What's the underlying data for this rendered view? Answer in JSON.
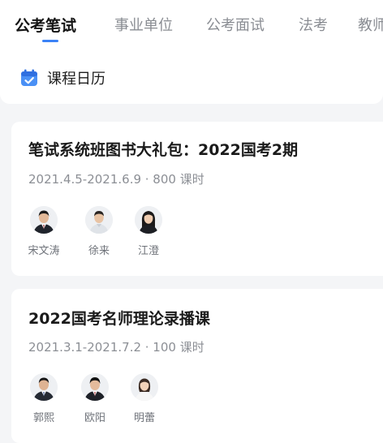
{
  "tabs": [
    {
      "label": "公考笔试",
      "active": true
    },
    {
      "label": "事业单位",
      "active": false
    },
    {
      "label": "公考面试",
      "active": false
    },
    {
      "label": "法考",
      "active": false
    },
    {
      "label": "教师",
      "active": false
    }
  ],
  "calendar": {
    "label": "课程日历",
    "icon": "calendar-check-icon"
  },
  "courses": [
    {
      "title": "笔试系统班图书大礼包：2022国考2期",
      "meta": "2021.4.5-2021.6.9 · 800 课时",
      "teachers": [
        {
          "name": "宋文涛"
        },
        {
          "name": "徐来"
        },
        {
          "name": "江澄"
        }
      ]
    },
    {
      "title": "2022国考名师理论录播课",
      "meta": "2021.3.1-2021.7.2 · 100 课时",
      "teachers": [
        {
          "name": "郭熙"
        },
        {
          "name": "欧阳"
        },
        {
          "name": "明蕾"
        }
      ]
    }
  ],
  "colors": {
    "accent": "#3b82f6",
    "active_tab": "#141414",
    "inactive_tab": "#8a8d93"
  }
}
